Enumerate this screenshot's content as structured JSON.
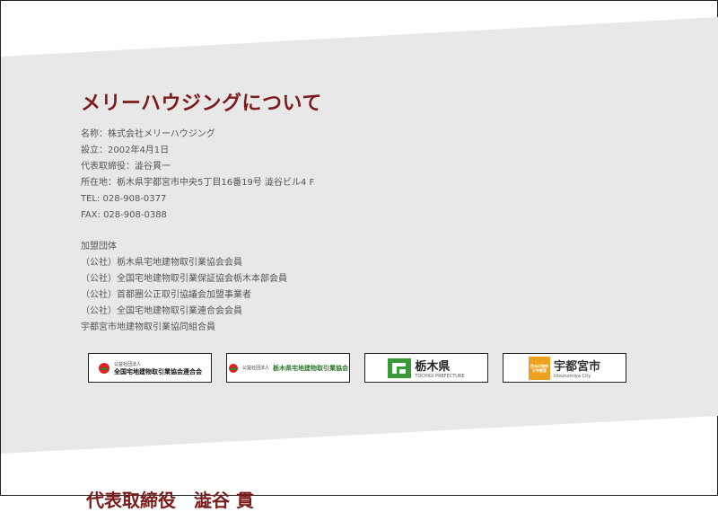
{
  "section": {
    "title": "メリーハウジングについて",
    "company": [
      "名称：株式会社メリーハウジング",
      "設立：2002年4月1日",
      "代表取締役：澁谷貫一",
      "所在地：栃木県宇都宮市中央5丁目16番19号 澁谷ビル4 F",
      "TEL: 028-908-0377",
      "FAX: 028-908-0388"
    ],
    "memberships_heading": "加盟団体",
    "memberships": [
      "（公社）栃木県宅地建物取引業協会会員",
      "（公社）全国宅地建物取引業保証協会栃木本部会員",
      "（公社）首都圏公正取引協議会加盟事業者",
      "（公社）全国宅地建物取引業連合会会員",
      "宇都宮市地建物取引業協同組合員"
    ]
  },
  "logos": {
    "zentaku": {
      "line1": "公益社団法人",
      "line2": "全国宅地建物取引業協会連合会"
    },
    "tochitaku": {
      "line1": "公益社団法人",
      "line2": "栃木県宅地建物取引業協会"
    },
    "tochigi": {
      "name": "栃木県",
      "sub": "TOCHIGI PREFECTURE"
    },
    "utsunomiya": {
      "mark": "住めば愉快だ宇都宮",
      "name": "宇都宮市",
      "sub": "Utsunomiya City"
    }
  },
  "next_section_title": "代表取締役　澁谷 貫",
  "colors": {
    "band": "#e8e8e8",
    "title": "#7a1c1c",
    "text": "#555555",
    "tochigi_green": "#3a9a3a",
    "utsunomiya_orange": "#f0a020"
  }
}
